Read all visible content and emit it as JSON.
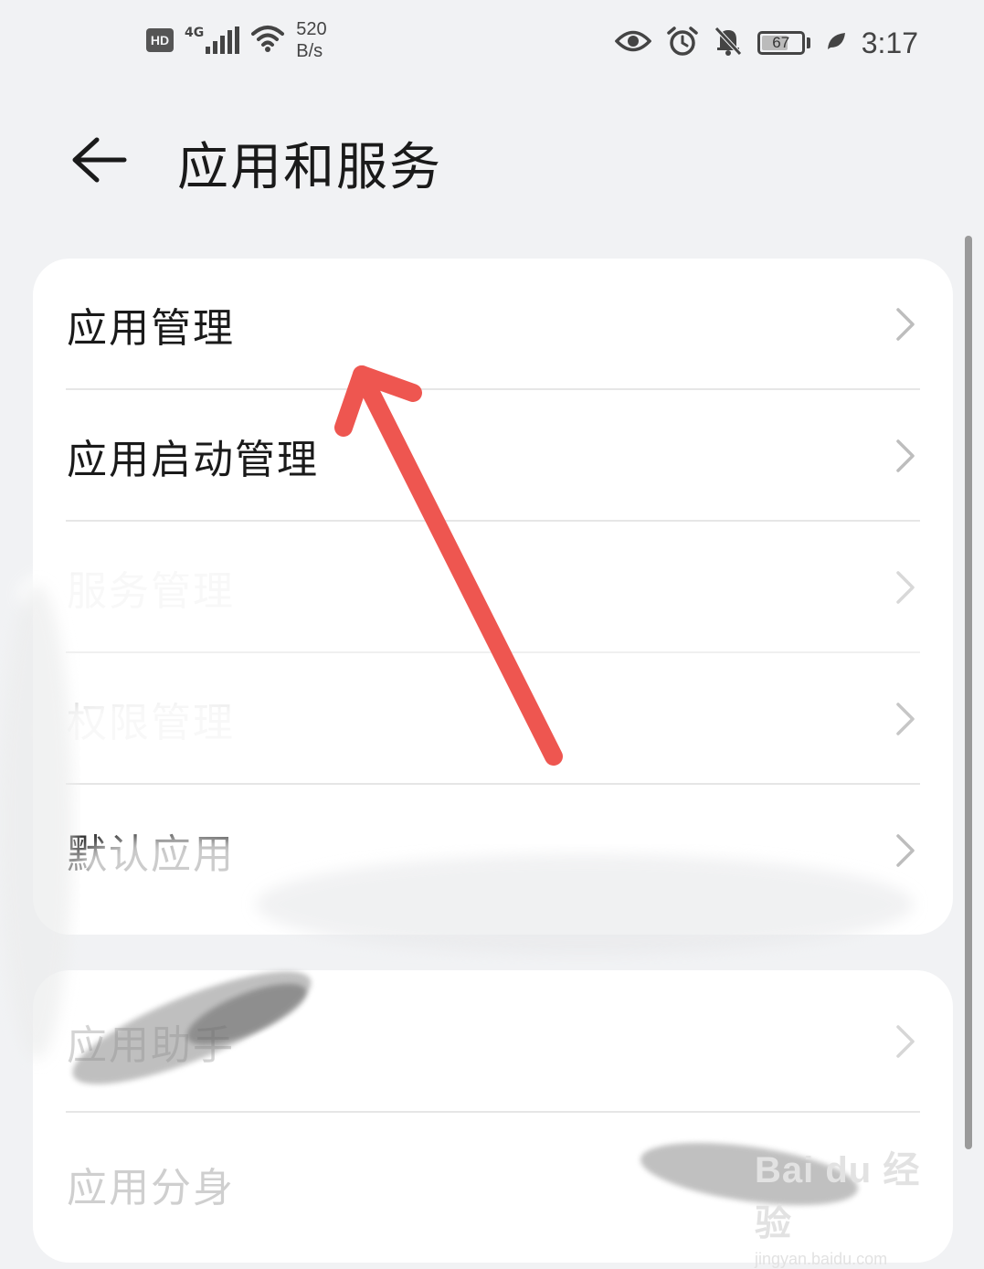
{
  "status_bar": {
    "hd_badge": "HD",
    "network_type": "4G",
    "speed_value": "520",
    "speed_unit": "B/s",
    "battery_level": "67",
    "time": "3:17"
  },
  "header": {
    "title": "应用和服务"
  },
  "section1": {
    "items": [
      {
        "label": "应用管理"
      },
      {
        "label": "应用启动管理"
      },
      {
        "label": "服务管理"
      },
      {
        "label": "权限管理"
      },
      {
        "label": "默认应用"
      }
    ]
  },
  "section2": {
    "items": [
      {
        "label": "应用助手"
      },
      {
        "label": "应用分身"
      }
    ]
  },
  "watermark": {
    "logo": "Bai du 经验",
    "url": "jingyan.baidu.com"
  },
  "annotation": {
    "arrow_color": "#ee5650"
  }
}
